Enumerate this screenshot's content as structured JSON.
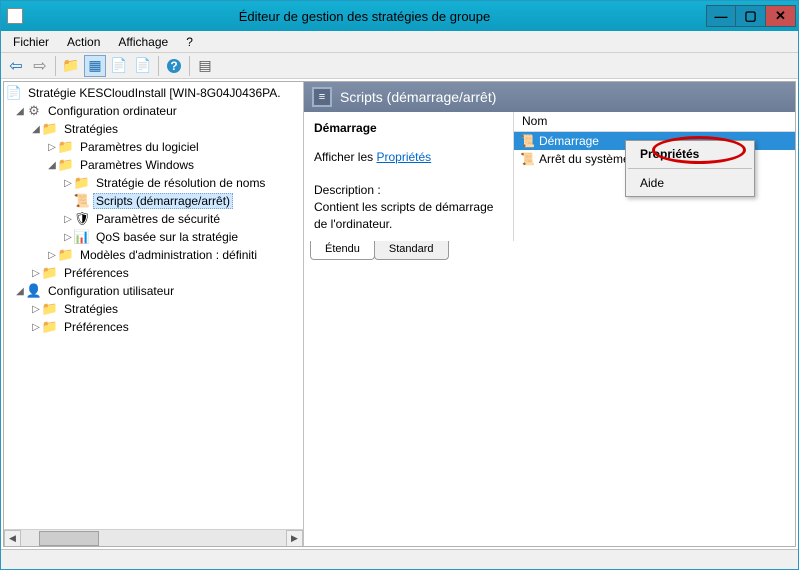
{
  "window": {
    "title": "Éditeur de gestion des stratégies de groupe"
  },
  "menu": {
    "file": "Fichier",
    "action": "Action",
    "view": "Affichage",
    "help": "?"
  },
  "tree": {
    "root": "Stratégie KESCloudInstall [WIN-8G04J0436PA.",
    "compConfig": "Configuration ordinateur",
    "strategies": "Stratégies",
    "softParams": "Paramètres du logiciel",
    "winParams": "Paramètres Windows",
    "nameRes": "Stratégie de résolution de noms",
    "scripts": "Scripts (démarrage/arrêt)",
    "secParams": "Paramètres de sécurité",
    "qos": "QoS basée sur la stratégie",
    "adminModels": "Modèles d'administration : définiti",
    "prefs": "Préférences",
    "userConfig": "Configuration utilisateur",
    "userStrategies": "Stratégies",
    "userPrefs": "Préférences"
  },
  "detail": {
    "panelTitle": "Scripts (démarrage/arrêt)",
    "startHeading": "Démarrage",
    "showPrefix": "Afficher les ",
    "propsLink": "Propriétés",
    "descLabel": "Description :",
    "descText": "Contient les scripts de démarrage de l'ordinateur."
  },
  "list": {
    "colName": "Nom",
    "item1": "Démarrage",
    "item2": "Arrêt du système"
  },
  "tabs": {
    "extended": "Étendu",
    "standard": "Standard"
  },
  "ctx": {
    "props": "Propriétés",
    "help": "Aide"
  }
}
